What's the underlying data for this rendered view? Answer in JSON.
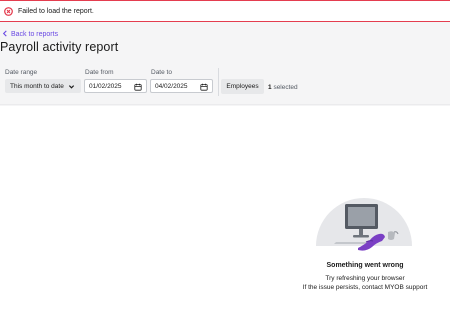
{
  "alert": {
    "message": "Failed to load the report.",
    "icon": "error-circle-icon",
    "color": "#e43d4f"
  },
  "header": {
    "back_label": "Back to reports",
    "title": "Payroll activity report",
    "link_color": "#6a4ae3"
  },
  "filters": {
    "date_range": {
      "label": "Date range",
      "value": "This month to date"
    },
    "date_from": {
      "label": "Date from",
      "value": "01/02/2025"
    },
    "date_to": {
      "label": "Date to",
      "value": "04/02/2025"
    },
    "employees_button": "Employees",
    "selected_count": "1",
    "selected_suffix": "selected"
  },
  "error_state": {
    "title": "Something went wrong",
    "line1": "Try refreshing your browser",
    "line2": "If the issue persists, contact MYOB support",
    "illustration": "spilled-drink-computer-illustration"
  }
}
